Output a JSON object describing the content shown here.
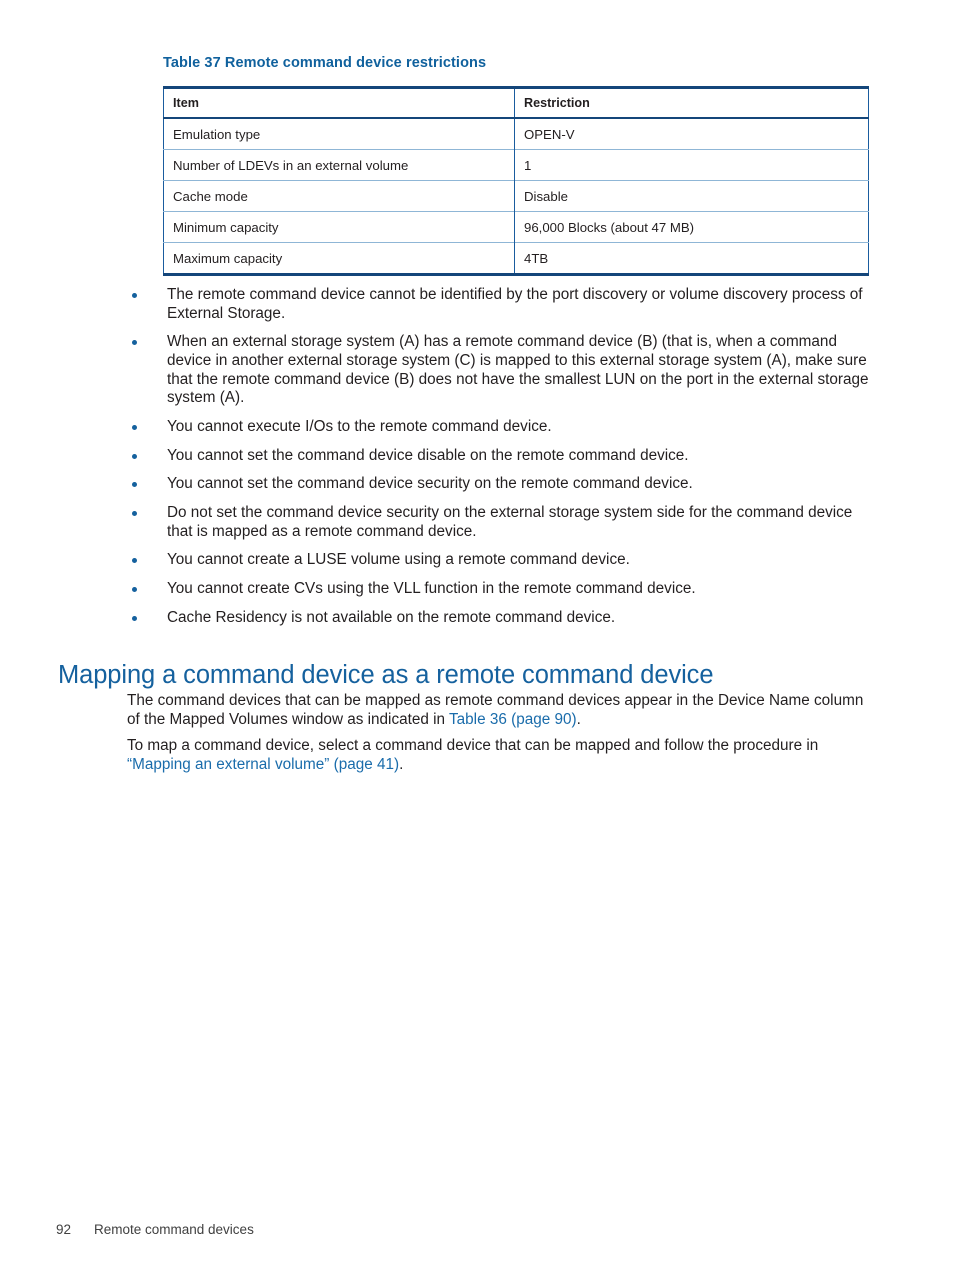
{
  "table": {
    "caption": "Table 37 Remote command device restrictions",
    "columns": [
      "Item",
      "Restriction"
    ],
    "rows": [
      {
        "item": "Emulation type",
        "restriction": "OPEN-V"
      },
      {
        "item": "Number of LDEVs in an external volume",
        "restriction": "1"
      },
      {
        "item": "Cache mode",
        "restriction": "Disable"
      },
      {
        "item": "Minimum capacity",
        "restriction": "96,000 Blocks (about 47 MB)"
      },
      {
        "item": "Maximum capacity",
        "restriction": "4TB"
      }
    ]
  },
  "bullets": [
    "The remote command device cannot be identified by the port discovery or volume discovery process of External Storage.",
    "When an external storage system (A) has a remote command device (B) (that is, when a command device in another external storage system (C) is mapped to this external storage system (A), make sure that the remote command device (B) does not have the smallest LUN on the port in the external storage system (A).",
    "You cannot execute I/Os to the remote command device.",
    "You cannot set the command device disable on the remote command device.",
    "You cannot set the command device security on the remote command device.",
    "Do not set the command device security on the external storage system side for the command device that is mapped as a remote command device.",
    "You cannot create a LUSE volume using a remote command device.",
    "You cannot create CVs using the VLL function in the remote command device.",
    "Cache Residency is not available on the remote command device."
  ],
  "section": {
    "heading": "Mapping a command device as a remote command device",
    "paragraph1_before": "The command devices that can be mapped as remote command devices appear in the Device Name column of the Mapped Volumes window as indicated in ",
    "paragraph1_link": "Table 36 (page 90)",
    "paragraph1_after": ".",
    "paragraph2_before": "To map a command device, select a command device that can be mapped and follow the procedure in ",
    "paragraph2_link": "“Mapping an external volume” (page 41)",
    "paragraph2_after": "."
  },
  "footer": {
    "page_number": "92",
    "chapter_title": "Remote command devices"
  },
  "colors": {
    "heading_blue": "#15619e",
    "caption_blue": "#10619d",
    "link_blue": "#1a6cab",
    "table_border_dark": "#14467a",
    "table_border_light": "#8fb6d6",
    "bullet_blue": "#15619e",
    "body_text": "#231f20"
  }
}
